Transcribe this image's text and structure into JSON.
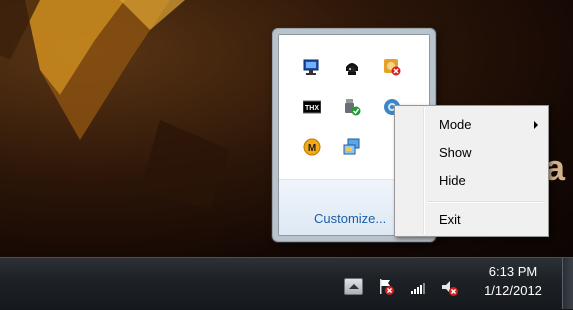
{
  "flyout": {
    "customize_label": "Customize...",
    "icons": [
      "display-settings-icon",
      "pirate-app-icon",
      "media-icon-error",
      "thx-icon",
      "usb-safely-remove-icon",
      "settings-icon",
      "megaupload-icon",
      "network-app-icon"
    ]
  },
  "context_menu": {
    "items": [
      {
        "label": "Mode",
        "has_submenu": true
      },
      {
        "label": "Show"
      },
      {
        "label": "Hide"
      },
      {
        "label": "Exit"
      }
    ]
  },
  "taskbar": {
    "time": "6:13 PM",
    "date": "1/12/2012",
    "icons": [
      "show-hidden-icons-button",
      "action-center-flag-icon",
      "network-signal-icon",
      "volume-muted-icon"
    ]
  }
}
